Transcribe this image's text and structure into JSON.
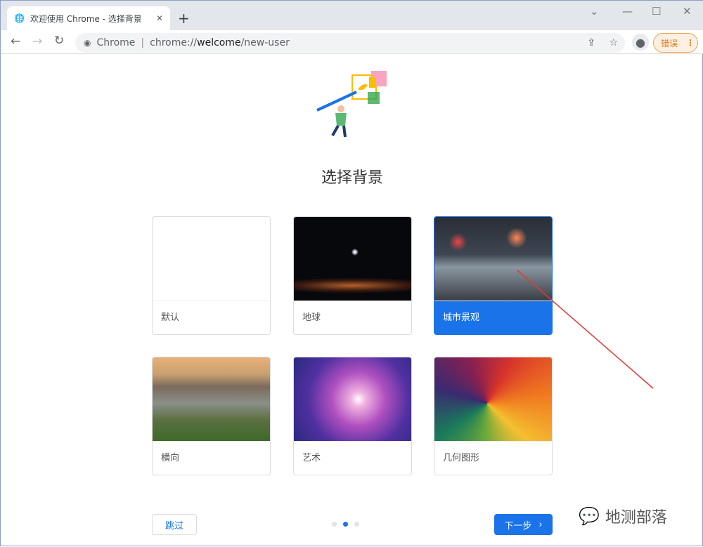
{
  "browser": {
    "tab_title": "欢迎使用 Chrome - 选择背景",
    "site_label": "Chrome",
    "url_prefix": "chrome://",
    "url_host": "welcome",
    "url_path": "/new-user",
    "profile_error": "错误"
  },
  "page": {
    "title": "选择背景",
    "skip": "跳过",
    "next": "下一步",
    "step": 2,
    "steps": 3
  },
  "backgrounds": [
    {
      "label": "默认"
    },
    {
      "label": "地球"
    },
    {
      "label": "城市景观",
      "selected": true
    },
    {
      "label": "横向"
    },
    {
      "label": "艺术"
    },
    {
      "label": "几何图形"
    }
  ],
  "watermark": "地测部落",
  "colors": {
    "accent": "#1a73e8",
    "annotation": "#e53935"
  }
}
